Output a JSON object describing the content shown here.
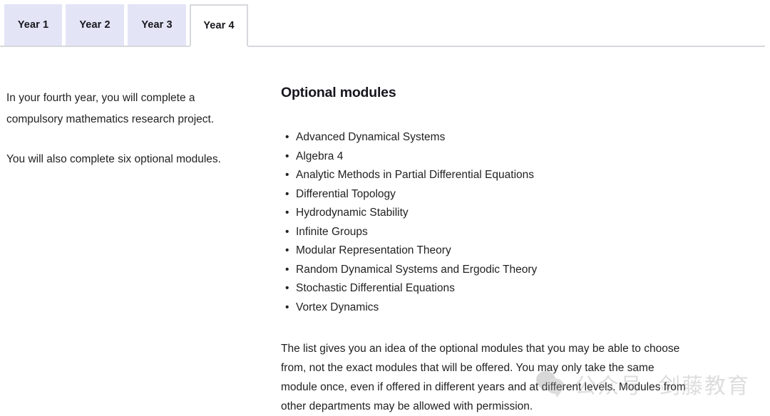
{
  "tabs": {
    "items": [
      {
        "label": "Year 1",
        "active": false
      },
      {
        "label": "Year 2",
        "active": false
      },
      {
        "label": "Year 3",
        "active": false
      },
      {
        "label": "Year 4",
        "active": true
      }
    ]
  },
  "left_column": {
    "paragraph_1": "In your fourth year, you will complete a compulsory mathematics research project.",
    "paragraph_2": "You will also complete six optional modules."
  },
  "right_column": {
    "heading": "Optional modules",
    "bullet_glyph": "•",
    "modules": [
      "Advanced Dynamical Systems",
      "Algebra 4",
      "Analytic Methods in Partial Differential Equations",
      "Differential Topology",
      "Hydrodynamic Stability",
      "Infinite Groups",
      "Modular Representation Theory",
      "Random Dynamical Systems and Ergodic Theory",
      "Stochastic Differential Equations",
      "Vortex Dynamics"
    ],
    "note": "The list gives you an idea of the optional modules that you may be able to choose from, not the exact modules that will be offered. You may only take the same module once, even if offered in different years and at different levels. Modules from other departments may be allowed with permission."
  },
  "watermark": {
    "prefix": "公众号",
    "brand": "剑藤教育",
    "icon": "wechat-icon"
  },
  "colors": {
    "tab_inactive_bg": "#e3e4f6",
    "tab_active_bg": "#ffffff",
    "tab_border": "#d6d8dc",
    "rule": "#d6d8dc",
    "text": "#222222",
    "heading": "#16161d"
  }
}
